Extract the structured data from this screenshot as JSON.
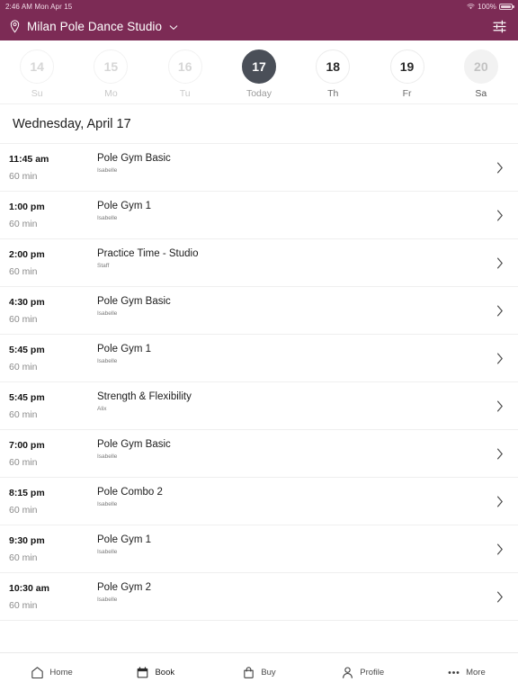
{
  "status_bar": {
    "time_date": "2:46 AM Mon Apr 15",
    "battery_percent": "100%",
    "wifi_icon": "wifi-icon",
    "battery_icon": "battery-icon"
  },
  "header": {
    "location_icon": "location-pin-icon",
    "studio_name": "Milan Pole Dance Studio",
    "dropdown_icon": "chevron-down-icon",
    "filter_icon": "filter-sliders-icon",
    "background_color": "#7c2b55"
  },
  "date_strip": {
    "selected_color": "#4a4f58",
    "days": [
      {
        "num": "14",
        "label": "Su",
        "state": "past"
      },
      {
        "num": "15",
        "label": "Mo",
        "state": "past"
      },
      {
        "num": "16",
        "label": "Tu",
        "state": "past"
      },
      {
        "num": "17",
        "label": "Today",
        "state": "today"
      },
      {
        "num": "18",
        "label": "Th",
        "state": "future"
      },
      {
        "num": "19",
        "label": "Fr",
        "state": "future"
      },
      {
        "num": "20",
        "label": "Sa",
        "state": "muted"
      }
    ]
  },
  "schedule": {
    "date_heading": "Wednesday, April 17",
    "chevron_icon": "chevron-right-icon",
    "classes": [
      {
        "time": "11:45 am",
        "duration": "60 min",
        "name": "Pole Gym Basic",
        "instructor": "Isabelle"
      },
      {
        "time": "1:00 pm",
        "duration": "60 min",
        "name": "Pole Gym 1",
        "instructor": "Isabelle"
      },
      {
        "time": "2:00 pm",
        "duration": "60 min",
        "name": "Practice Time - Studio",
        "instructor": "Staff"
      },
      {
        "time": "4:30 pm",
        "duration": "60 min",
        "name": "Pole Gym Basic",
        "instructor": "Isabelle"
      },
      {
        "time": "5:45 pm",
        "duration": "60 min",
        "name": "Pole Gym 1",
        "instructor": "Isabelle"
      },
      {
        "time": "5:45 pm",
        "duration": "60 min",
        "name": "Strength & Flexibility",
        "instructor": "Alix"
      },
      {
        "time": "7:00 pm",
        "duration": "60 min",
        "name": "Pole Gym Basic",
        "instructor": "Isabelle"
      },
      {
        "time": "8:15 pm",
        "duration": "60 min",
        "name": "Pole Combo 2",
        "instructor": "Isabelle"
      },
      {
        "time": "9:30 pm",
        "duration": "60 min",
        "name": "Pole Gym 1",
        "instructor": "Isabelle"
      },
      {
        "time": "10:30 am",
        "duration": "60 min",
        "name": "Pole Gym 2",
        "instructor": "Isabelle"
      }
    ]
  },
  "bottom_nav": {
    "items": [
      {
        "label": "Home",
        "icon": "home-icon",
        "active": false
      },
      {
        "label": "Book",
        "icon": "calendar-icon",
        "active": true
      },
      {
        "label": "Buy",
        "icon": "shopping-bag-icon",
        "active": false
      },
      {
        "label": "Profile",
        "icon": "person-icon",
        "active": false
      },
      {
        "label": "More",
        "icon": "ellipsis-icon",
        "active": false
      }
    ]
  }
}
